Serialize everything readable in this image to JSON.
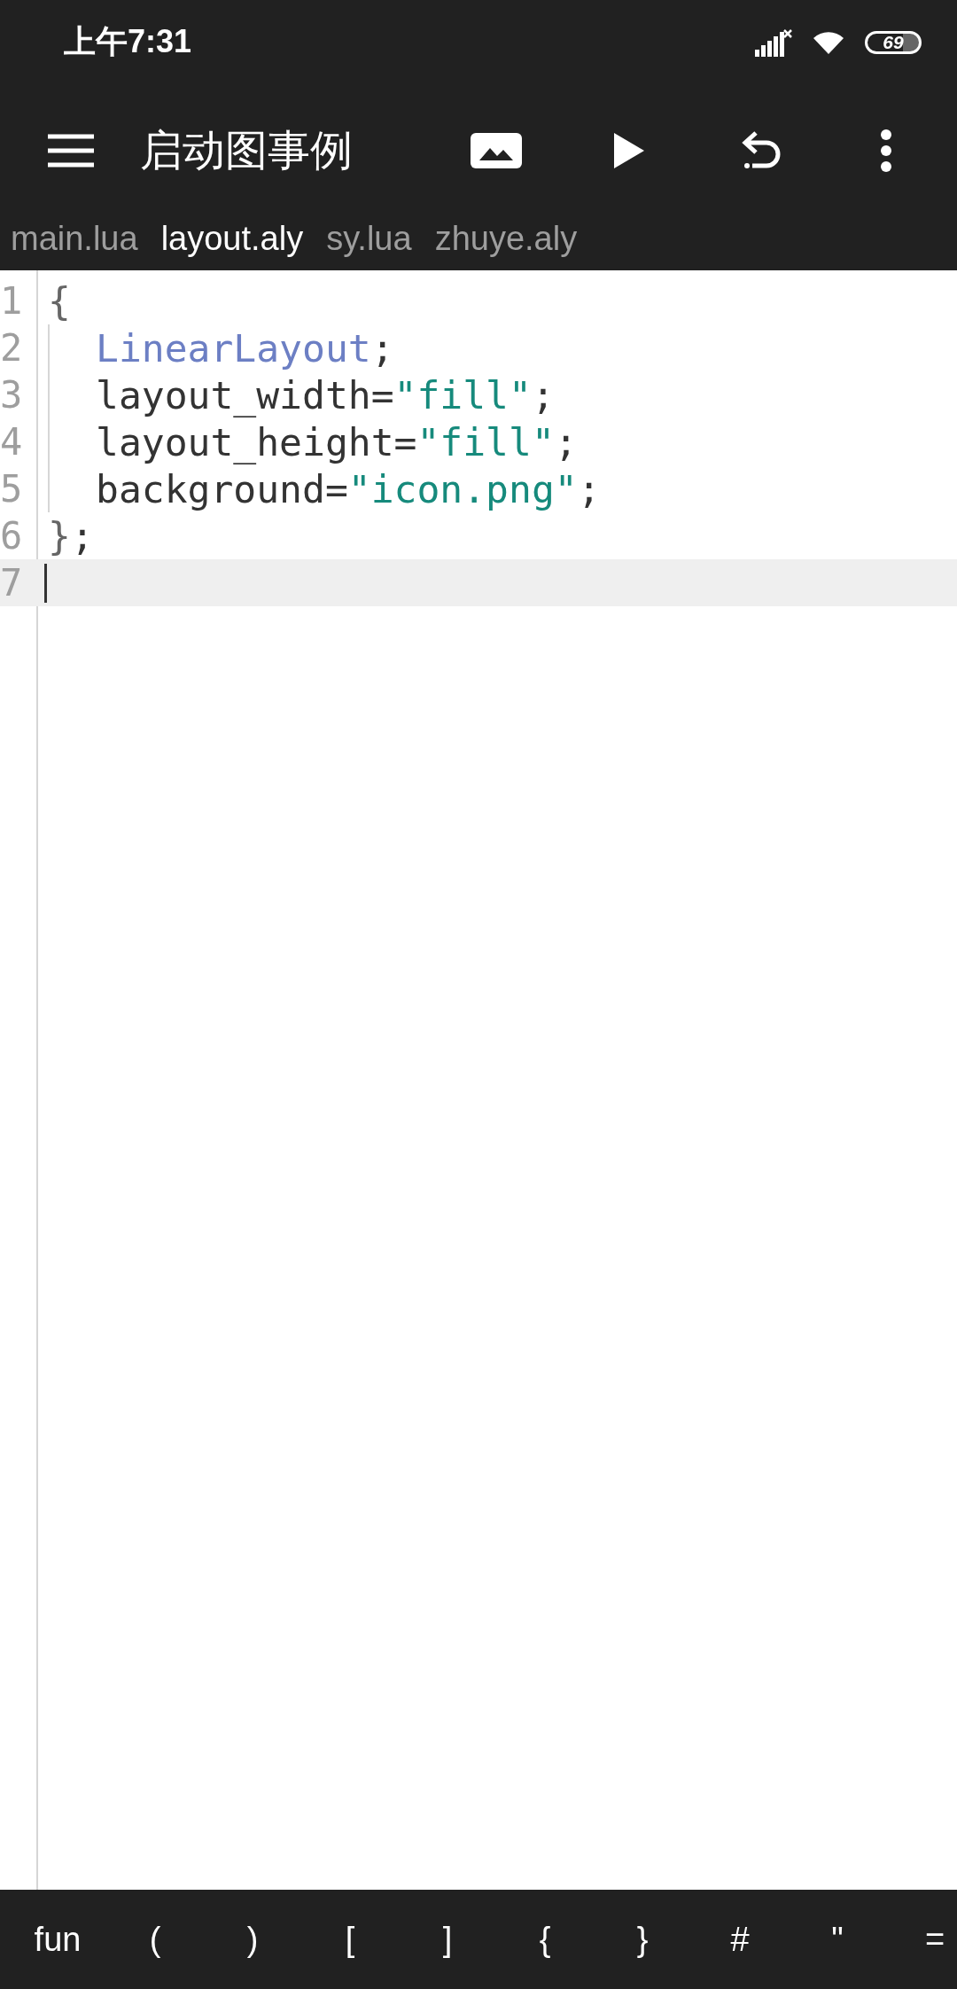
{
  "status_bar": {
    "time": "上午7:31",
    "battery": "69"
  },
  "toolbar": {
    "title": "启动图事例"
  },
  "tabs": [
    {
      "label": "main.lua",
      "selected": false
    },
    {
      "label": "layout.aly",
      "selected": true
    },
    {
      "label": "sy.lua",
      "selected": false
    },
    {
      "label": "zhuye.aly",
      "selected": false
    }
  ],
  "editor": {
    "lines": [
      {
        "number": "1",
        "current": false,
        "tokens": [
          {
            "kind": "punct",
            "text": "{"
          }
        ]
      },
      {
        "number": "2",
        "current": false,
        "indent": true,
        "tokens": [
          {
            "kind": "keyword",
            "text": "LinearLayout"
          },
          {
            "kind": "plain",
            "text": ";"
          }
        ]
      },
      {
        "number": "3",
        "current": false,
        "indent": true,
        "tokens": [
          {
            "kind": "plain",
            "text": "layout_width="
          },
          {
            "kind": "string",
            "text": "\"fill\""
          },
          {
            "kind": "plain",
            "text": ";"
          }
        ]
      },
      {
        "number": "4",
        "current": false,
        "indent": true,
        "tokens": [
          {
            "kind": "plain",
            "text": "layout_height="
          },
          {
            "kind": "string",
            "text": "\"fill\""
          },
          {
            "kind": "plain",
            "text": ";"
          }
        ]
      },
      {
        "number": "5",
        "current": false,
        "indent": true,
        "tokens": [
          {
            "kind": "plain",
            "text": "background="
          },
          {
            "kind": "string",
            "text": "\"icon.png\""
          },
          {
            "kind": "plain",
            "text": ";"
          }
        ]
      },
      {
        "number": "6",
        "current": false,
        "tokens": [
          {
            "kind": "punct",
            "text": "}"
          },
          {
            "kind": "plain",
            "text": ";"
          }
        ]
      },
      {
        "number": "7",
        "current": true
      }
    ]
  },
  "symbol_bar": [
    "fun",
    "(",
    ")",
    "[",
    "]",
    "{",
    "}",
    "#",
    "\"",
    "="
  ]
}
